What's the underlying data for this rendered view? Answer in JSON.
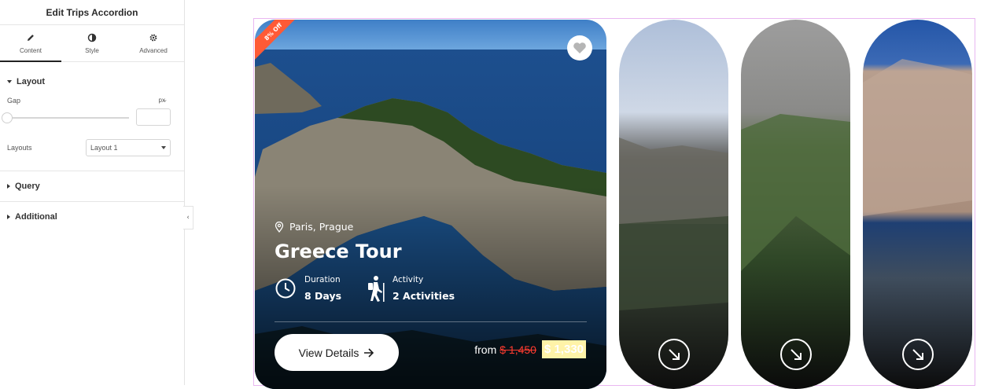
{
  "editor": {
    "title": "Edit Trips Accordion",
    "tabs": [
      {
        "label": "Content",
        "icon": "pencil-icon"
      },
      {
        "label": "Style",
        "icon": "contrast-icon"
      },
      {
        "label": "Advanced",
        "icon": "gear-icon"
      }
    ],
    "layout_section": {
      "label": "Layout",
      "gap_label": "Gap",
      "gap_unit": "px",
      "gap_value": "",
      "layouts_label": "Layouts",
      "layouts_value": "Layout 1"
    },
    "query_label": "Query",
    "additional_label": "Additional"
  },
  "featured_trip": {
    "badge": "8% Off",
    "location": "Paris, Prague",
    "title": "Greece Tour",
    "duration_label": "Duration",
    "duration_value": "8 Days",
    "activity_label": "Activity",
    "activity_value": "2 Activities",
    "button_label": "View Details",
    "price_prefix": "from",
    "old_price": "$ 1,450",
    "new_price": "$ 1,330"
  },
  "colors": {
    "badge": "#ff5a36",
    "old_price": "#ff3b2f",
    "highlight": "#fff3a8",
    "stage_border": "#e9b7f1"
  }
}
